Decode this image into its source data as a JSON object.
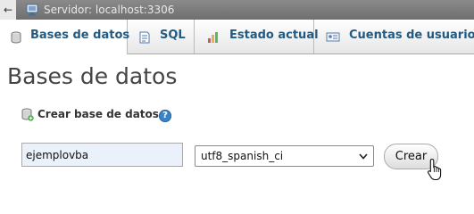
{
  "server_bar": {
    "back_label": "←",
    "title": "Servidor: localhost:3306"
  },
  "tabs": [
    {
      "label": "Bases de datos",
      "icon": "database-icon",
      "active": true
    },
    {
      "label": "SQL",
      "icon": "sql-icon",
      "active": false
    },
    {
      "label": "Estado actual",
      "icon": "chart-icon",
      "active": false
    },
    {
      "label": "Cuentas de usuarios",
      "icon": "users-icon",
      "active": false
    }
  ],
  "page": {
    "title": "Bases de datos"
  },
  "create_db": {
    "label": "Crear base de datos",
    "help_glyph": "?",
    "name_value": "ejemplovba",
    "collation_value": "utf8_spanish_ci",
    "button_label": "Crear"
  }
}
